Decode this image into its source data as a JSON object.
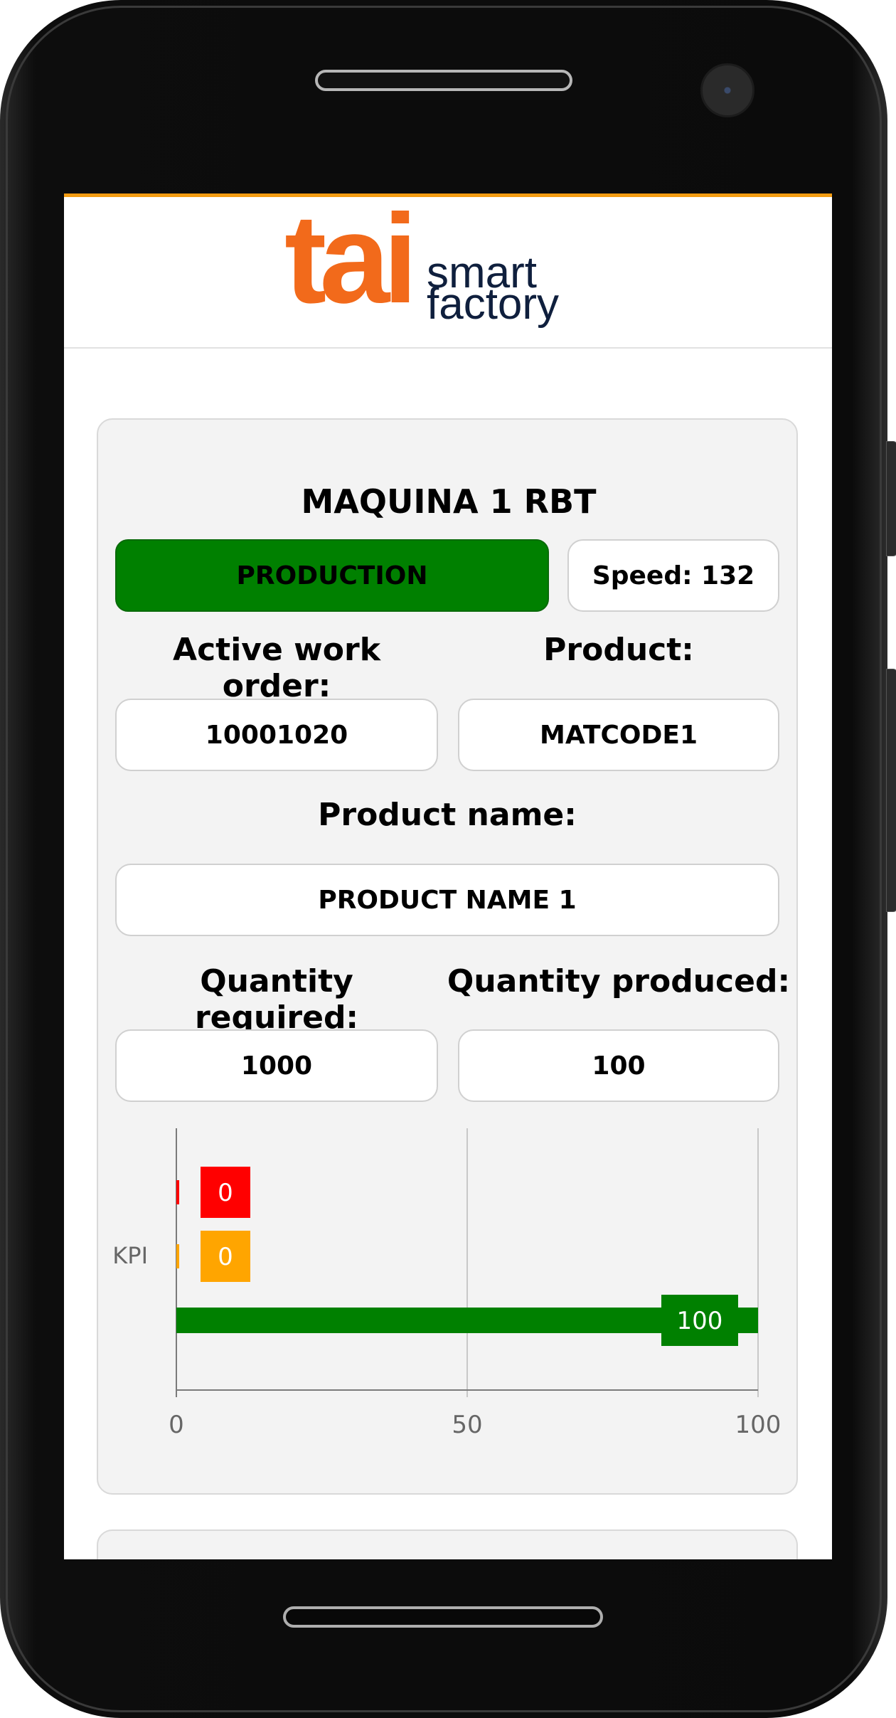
{
  "app": {
    "logo": {
      "brand": "tai",
      "line1": "smart",
      "line2": "factory"
    },
    "colors": {
      "accent": "#f39c12",
      "logo_orange": "#f26a1b",
      "logo_navy": "#0f1f3d",
      "status_production": "#008000"
    }
  },
  "machine": {
    "title": "MAQUINA 1 RBT",
    "status": "PRODUCTION",
    "speed": "Speed: 132",
    "active_work_order_label": "Active work order:",
    "active_work_order": "10001020",
    "product_label": "Product:",
    "product": "MATCODE1",
    "product_name_label": "Product name:",
    "product_name": "PRODUCT NAME 1",
    "quantity_required_label": "Quantity required:",
    "quantity_required": "1000",
    "quantity_produced_label": "Quantity produced:",
    "quantity_produced": "100"
  },
  "chart_data": {
    "type": "bar",
    "orientation": "horizontal",
    "categories": [
      "KPI"
    ],
    "series": [
      {
        "values": [
          0
        ],
        "color": "#ff0000"
      },
      {
        "values": [
          0
        ],
        "color": "#ffa500"
      },
      {
        "values": [
          100
        ],
        "color": "#008000"
      }
    ],
    "xlim": [
      0,
      100
    ],
    "xticks": [
      0,
      50,
      100
    ],
    "grid": true
  }
}
